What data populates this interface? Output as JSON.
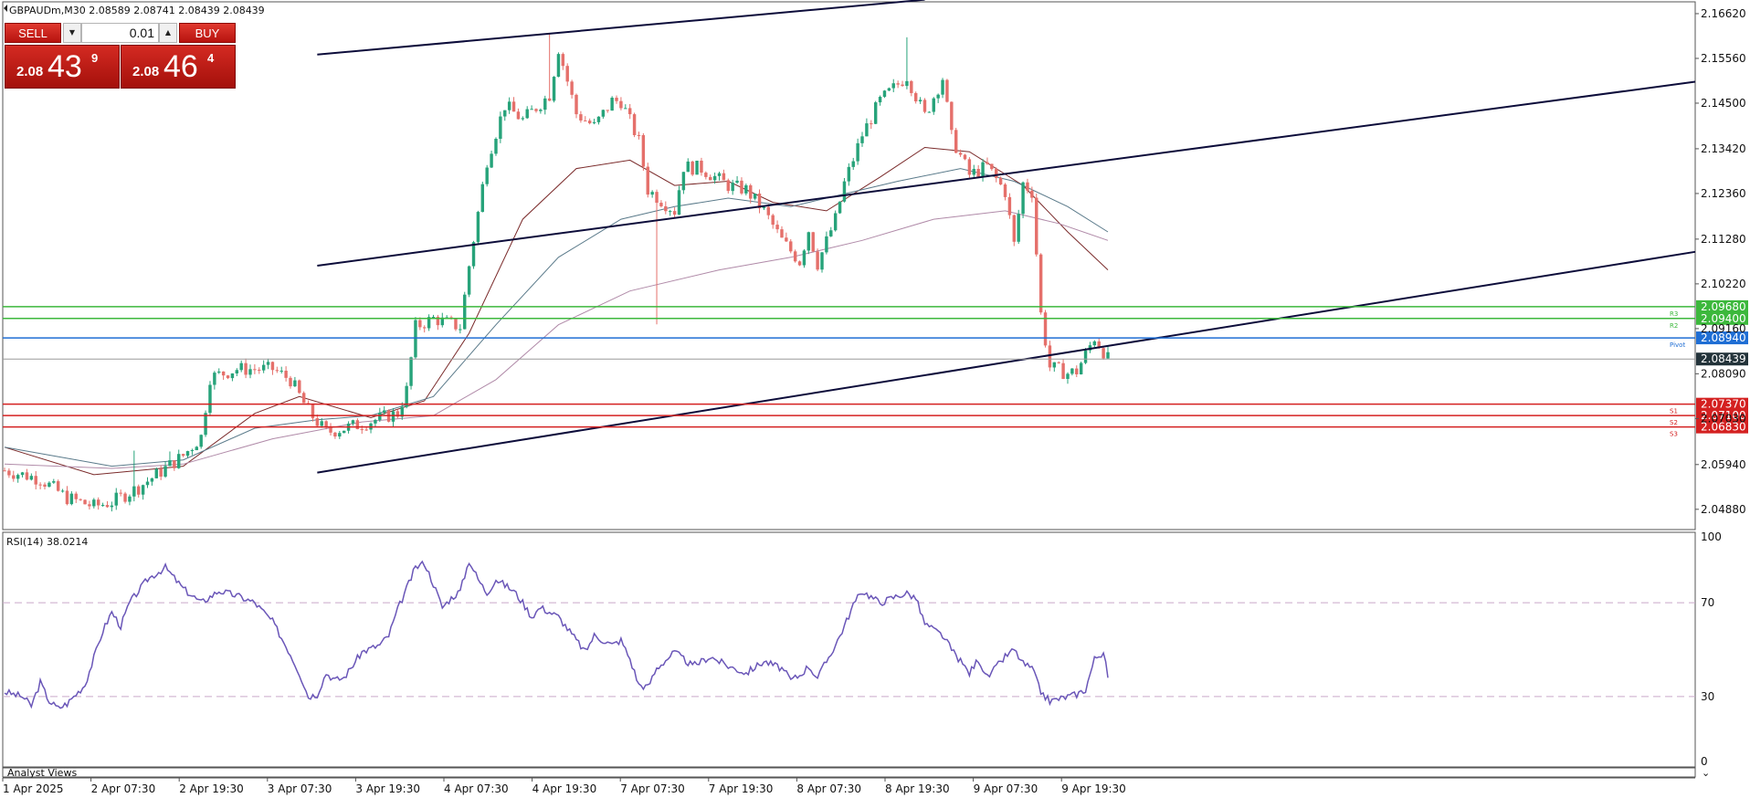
{
  "header": {
    "symbol_line": "GBPAUDm,M30  2.08589 2.08741 2.08439 2.08439"
  },
  "trade_panel": {
    "sell_label": "SELL",
    "buy_label": "BUY",
    "lot_value": "0.01",
    "sell_price_small": "2.08",
    "sell_price_big": "43",
    "sell_price_sup": "9",
    "buy_price_small": "2.08",
    "buy_price_big": "46",
    "buy_price_sup": "4"
  },
  "indicator": {
    "label": "RSI(14) 38.0214"
  },
  "bottom_tab": {
    "label": "Analyst Views"
  },
  "chart_data": [
    {
      "type": "candlestick",
      "symbol": "GBPAUDm",
      "timeframe": "M30",
      "ohlc_last": {
        "open": 2.08589,
        "high": 2.08741,
        "low": 2.08439,
        "close": 2.08439
      },
      "ylim": [
        2.044,
        2.169
      ],
      "y_ticks": [
        2.1662,
        2.1556,
        2.145,
        2.1342,
        2.1236,
        2.1128,
        2.1022,
        2.0916,
        2.0809,
        2.0703,
        2.0594,
        2.0488
      ],
      "y_tick_labels": [
        "2.16620",
        "2.15560",
        "2.14500",
        "2.13420",
        "2.12360",
        "2.11280",
        "2.10220",
        "2.09160",
        "2.08090",
        "2.07030",
        "2.05940",
        "2.04880"
      ],
      "x_tick_labels": [
        "1 Apr 2025",
        "2 Apr 07:30",
        "2 Apr 19:30",
        "3 Apr 07:30",
        "3 Apr 19:30",
        "4 Apr 07:30",
        "4 Apr 19:30",
        "7 Apr 07:30",
        "7 Apr 19:30",
        "8 Apr 07:30",
        "8 Apr 19:30",
        "9 Apr 07:30",
        "9 Apr 19:30"
      ],
      "bar_range": [
        0,
        247
      ],
      "close_path": [
        [
          0,
          2.058
        ],
        [
          8,
          2.056
        ],
        [
          14,
          2.0515
        ],
        [
          20,
          2.0495
        ],
        [
          24,
          2.0505
        ],
        [
          30,
          2.054
        ],
        [
          36,
          2.0585
        ],
        [
          40,
          2.0615
        ],
        [
          44,
          2.066
        ],
        [
          46,
          2.08
        ],
        [
          52,
          2.082
        ],
        [
          60,
          2.082
        ],
        [
          64,
          2.0795
        ],
        [
          68,
          2.072
        ],
        [
          72,
          2.067
        ],
        [
          80,
          2.069
        ],
        [
          86,
          2.071
        ],
        [
          88,
          2.0715
        ],
        [
          90,
          2.077
        ],
        [
          92,
          2.092
        ],
        [
          96,
          2.094
        ],
        [
          102,
          2.092
        ],
        [
          104,
          2.1065
        ],
        [
          108,
          2.1315
        ],
        [
          112,
          2.1445
        ],
        [
          116,
          2.141
        ],
        [
          122,
          2.147
        ],
        [
          124,
          2.158
        ],
        [
          128,
          2.1425
        ],
        [
          132,
          2.1395
        ],
        [
          136,
          2.1455
        ],
        [
          138,
          2.1455
        ],
        [
          142,
          2.136
        ],
        [
          144,
          2.1245
        ],
        [
          150,
          2.1195
        ],
        [
          152,
          2.13
        ],
        [
          156,
          2.1295
        ],
        [
          162,
          2.1255
        ],
        [
          166,
          2.1245
        ],
        [
          170,
          2.1195
        ],
        [
          174,
          2.1125
        ],
        [
          178,
          2.1075
        ],
        [
          180,
          2.115
        ],
        [
          182,
          2.107
        ],
        [
          186,
          2.1175
        ],
        [
          188,
          2.126
        ],
        [
          192,
          2.1375
        ],
        [
          196,
          2.1455
        ],
        [
          202,
          2.1515
        ],
        [
          206,
          2.142
        ],
        [
          210,
          2.151
        ],
        [
          212,
          2.137
        ],
        [
          216,
          2.128
        ],
        [
          220,
          2.13
        ],
        [
          224,
          2.124
        ],
        [
          226,
          2.1115
        ],
        [
          228,
          2.126
        ],
        [
          230,
          2.124
        ],
        [
          232,
          2.095
        ],
        [
          234,
          2.0825
        ],
        [
          238,
          2.081
        ],
        [
          240,
          2.0815
        ],
        [
          244,
          2.0895
        ],
        [
          246,
          2.0862
        ],
        [
          247,
          2.0844
        ]
      ],
      "spikes": [
        [
          29,
          2.0627
        ],
        [
          37,
          2.0625
        ],
        [
          122,
          2.1616
        ],
        [
          146,
          2.0926
        ],
        [
          202,
          2.1606
        ]
      ],
      "moving_averages": [
        {
          "color": "#7a2a2a",
          "points": [
            [
              0,
              2.0635
            ],
            [
              20,
              2.057
            ],
            [
              40,
              2.059
            ],
            [
              56,
              2.0715
            ],
            [
              66,
              2.0755
            ],
            [
              82,
              2.0705
            ],
            [
              94,
              2.0745
            ],
            [
              104,
              2.0905
            ],
            [
              116,
              2.1175
            ],
            [
              128,
              2.1295
            ],
            [
              140,
              2.1315
            ],
            [
              150,
              2.1255
            ],
            [
              162,
              2.1265
            ],
            [
              172,
              2.1215
            ],
            [
              184,
              2.1195
            ],
            [
              196,
              2.1275
            ],
            [
              206,
              2.1345
            ],
            [
              216,
              2.1335
            ],
            [
              228,
              2.1255
            ],
            [
              238,
              2.1145
            ],
            [
              247,
              2.1055
            ]
          ]
        },
        {
          "color": "#5a7a8a",
          "points": [
            [
              0,
              2.0635
            ],
            [
              24,
              2.059
            ],
            [
              40,
              2.0605
            ],
            [
              56,
              2.068
            ],
            [
              70,
              2.07
            ],
            [
              82,
              2.071
            ],
            [
              96,
              2.0755
            ],
            [
              110,
              2.0925
            ],
            [
              124,
              2.1085
            ],
            [
              138,
              2.1175
            ],
            [
              150,
              2.1205
            ],
            [
              162,
              2.1225
            ],
            [
              176,
              2.1205
            ],
            [
              188,
              2.1235
            ],
            [
              200,
              2.1265
            ],
            [
              214,
              2.1295
            ],
            [
              226,
              2.1265
            ],
            [
              238,
              2.1205
            ],
            [
              247,
              2.1145
            ]
          ]
        },
        {
          "color": "#b08aa8",
          "points": [
            [
              0,
              2.0595
            ],
            [
              24,
              2.0585
            ],
            [
              40,
              2.0595
            ],
            [
              60,
              2.0655
            ],
            [
              80,
              2.0695
            ],
            [
              96,
              2.071
            ],
            [
              110,
              2.0795
            ],
            [
              124,
              2.0925
            ],
            [
              140,
              2.1005
            ],
            [
              160,
              2.1055
            ],
            [
              176,
              2.1085
            ],
            [
              192,
              2.1125
            ],
            [
              208,
              2.1175
            ],
            [
              224,
              2.1195
            ],
            [
              236,
              2.1165
            ],
            [
              247,
              2.1125
            ]
          ]
        }
      ],
      "channel_lines": [
        {
          "from": [
            70,
            2.1565
          ],
          "to": [
            206,
            2.1695
          ]
        },
        {
          "from": [
            70,
            2.1065
          ],
          "to": [
            247,
            2.1315
          ],
          "extend_to_edge": true
        },
        {
          "from": [
            70,
            2.0575
          ],
          "to": [
            247,
            2.0875
          ],
          "extend_to_edge": true
        }
      ],
      "horizontal_levels": [
        {
          "label": "R3",
          "value": 2.0968,
          "tag": "2.09680",
          "color": "#3cb83c"
        },
        {
          "label": "R2",
          "value": 2.094,
          "tag": "2.09400",
          "color": "#3cb83c"
        },
        {
          "label": "Pivot",
          "value": 2.0894,
          "tag": "2.08940",
          "color": "#1f6ed4"
        },
        {
          "label": "",
          "value": 2.08439,
          "tag": "2.08439",
          "color": "#9a9a9a",
          "tag_bg": "#23333a"
        },
        {
          "label": "S1",
          "value": 2.0737,
          "tag": "2.07370",
          "color": "#d42020"
        },
        {
          "label": "S2",
          "value": 2.071,
          "tag": "2.07100",
          "color": "#d42020"
        },
        {
          "label": "S3",
          "value": 2.0683,
          "tag": "2.06830",
          "color": "#d42020"
        }
      ],
      "colors": {
        "bull": "#27a37a",
        "bear": "#e5706b",
        "grid": "#bfbfbf"
      }
    },
    {
      "type": "line",
      "indicator": "RSI",
      "period": 14,
      "last_value": 38.0214,
      "ylim": [
        0,
        100
      ],
      "y_tick_labels": [
        "100",
        "70",
        "30",
        "0"
      ],
      "levels": [
        70,
        30
      ],
      "color": "#6a56b8",
      "x_range": [
        0,
        247
      ],
      "points": [
        [
          0,
          32
        ],
        [
          4,
          30
        ],
        [
          6,
          26
        ],
        [
          8,
          36
        ],
        [
          10,
          28
        ],
        [
          12,
          25
        ],
        [
          14,
          27
        ],
        [
          18,
          35
        ],
        [
          22,
          58
        ],
        [
          24,
          66
        ],
        [
          26,
          60
        ],
        [
          28,
          70
        ],
        [
          32,
          80
        ],
        [
          36,
          85
        ],
        [
          40,
          76
        ],
        [
          44,
          70
        ],
        [
          48,
          75
        ],
        [
          52,
          73
        ],
        [
          56,
          70
        ],
        [
          60,
          62
        ],
        [
          64,
          48
        ],
        [
          66,
          40
        ],
        [
          68,
          30
        ],
        [
          70,
          31
        ],
        [
          72,
          40
        ],
        [
          74,
          37
        ],
        [
          76,
          38
        ],
        [
          80,
          49
        ],
        [
          84,
          52
        ],
        [
          86,
          56
        ],
        [
          88,
          67
        ],
        [
          90,
          76
        ],
        [
          92,
          85
        ],
        [
          94,
          87
        ],
        [
          96,
          78
        ],
        [
          98,
          68
        ],
        [
          100,
          72
        ],
        [
          102,
          75
        ],
        [
          104,
          88
        ],
        [
          106,
          80
        ],
        [
          108,
          74
        ],
        [
          110,
          80
        ],
        [
          114,
          75
        ],
        [
          116,
          70
        ],
        [
          118,
          64
        ],
        [
          120,
          68
        ],
        [
          124,
          64
        ],
        [
          128,
          54
        ],
        [
          130,
          49
        ],
        [
          132,
          56
        ],
        [
          136,
          52
        ],
        [
          138,
          54
        ],
        [
          140,
          46
        ],
        [
          142,
          35
        ],
        [
          144,
          34
        ],
        [
          146,
          42
        ],
        [
          150,
          49
        ],
        [
          154,
          43
        ],
        [
          158,
          47
        ],
        [
          162,
          43
        ],
        [
          166,
          40
        ],
        [
          170,
          45
        ],
        [
          174,
          42
        ],
        [
          176,
          37
        ],
        [
          178,
          39
        ],
        [
          180,
          43
        ],
        [
          182,
          38
        ],
        [
          186,
          52
        ],
        [
          188,
          60
        ],
        [
          190,
          69
        ],
        [
          192,
          75
        ],
        [
          196,
          70
        ],
        [
          200,
          73
        ],
        [
          202,
          74
        ],
        [
          204,
          72
        ],
        [
          206,
          61
        ],
        [
          210,
          56
        ],
        [
          212,
          50
        ],
        [
          214,
          45
        ],
        [
          216,
          40
        ],
        [
          218,
          46
        ],
        [
          220,
          38
        ],
        [
          224,
          47
        ],
        [
          226,
          50
        ],
        [
          228,
          44
        ],
        [
          230,
          42
        ],
        [
          232,
          32
        ],
        [
          234,
          28
        ],
        [
          238,
          30
        ],
        [
          240,
          31
        ],
        [
          242,
          33
        ],
        [
          244,
          46
        ],
        [
          246,
          49
        ],
        [
          247,
          38.02
        ]
      ]
    }
  ]
}
